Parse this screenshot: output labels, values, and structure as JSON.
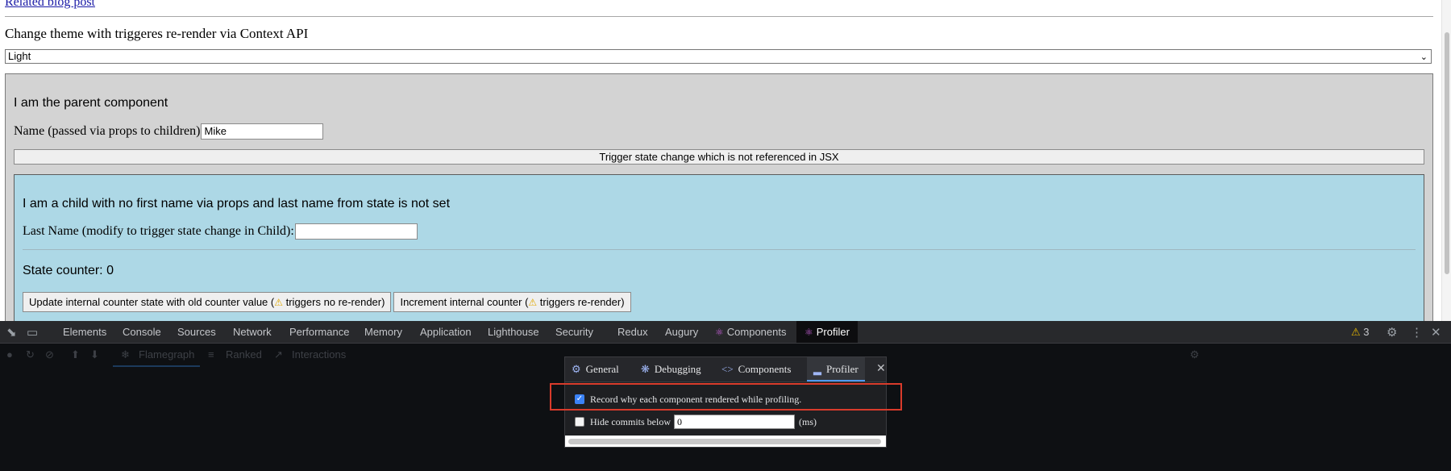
{
  "page": {
    "blog_link": "Related blog post",
    "theme_label": "Change theme with triggeres re-render via Context API",
    "theme_select_value": "Light",
    "parent": {
      "title": "I am the parent component",
      "name_label": "Name (passed via props to children)",
      "name_value": "Mike",
      "trigger_button": "Trigger state change which is not referenced in JSX"
    },
    "child": {
      "title": "I am a child with no first name via props and last name from state is not set",
      "last_name_label": "Last Name (modify to trigger state change in Child):",
      "last_name_value": "",
      "counter_text": "State counter: 0",
      "update_button_a": "Update internal counter state with old counter value (",
      "update_button_b": " triggers no re-render)",
      "increment_button_a": "Increment internal counter (",
      "increment_button_b": " triggers re-render)"
    }
  },
  "devtools": {
    "tabs": [
      "Elements",
      "Console",
      "Sources",
      "Network",
      "Performance",
      "Memory",
      "Application",
      "Lighthouse",
      "Security",
      "Redux",
      "Augury",
      "Components",
      "Profiler"
    ],
    "active_tab": "Profiler",
    "warning_count": "3",
    "accent_color": "#4f9af6",
    "profiler_subtabs": [
      "Flamegraph",
      "Ranked",
      "Interactions"
    ]
  },
  "settings": {
    "tabs": [
      "General",
      "Debugging",
      "Components",
      "Profiler"
    ],
    "active_tab": "Profiler",
    "record_label": "Record why each component rendered while profiling.",
    "record_checked": true,
    "hide_label": "Hide commits below",
    "hide_checked": false,
    "hide_value": "0",
    "hide_unit": "(ms)",
    "highlight_color": "#d93b2b"
  }
}
